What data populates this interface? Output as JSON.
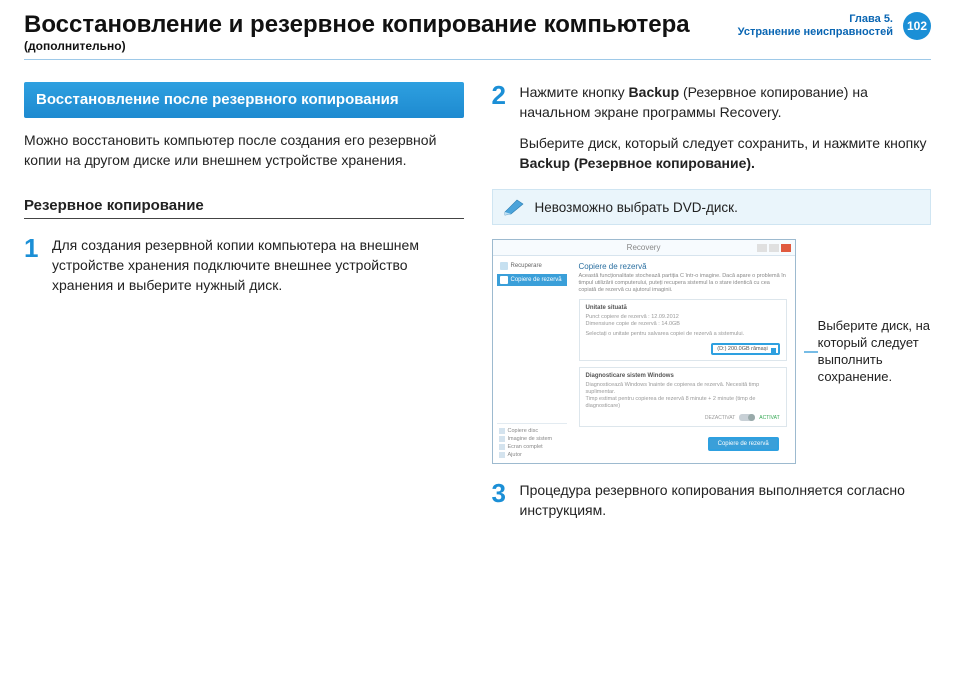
{
  "header": {
    "title": "Восстановление и резервное копирование компьютера",
    "subtitle": "(дополнительно)",
    "chapter_line1": "Глава 5.",
    "chapter_line2": "Устранение неисправностей",
    "page_number": "102"
  },
  "left": {
    "section_heading": "Восстановление после резервного копирования",
    "intro": "Можно восстановить компьютер после создания его резервной копии на другом диске или внешнем устройстве хранения.",
    "subhead": "Резервное копирование",
    "step1_num": "1",
    "step1_text": "Для создания резервной копии компьютера на внешнем устройстве хранения подключите внешнее устройство хранения и выберите нужный диск."
  },
  "right": {
    "step2_num": "2",
    "step2_text_pre": "Нажмите кнопку ",
    "step2_bold1": "Backup",
    "step2_text_mid": " (Резервное копирование) на начальном экране программы Recovery.",
    "step2b_pre": "Выберите диск, который следует сохранить, и нажмите кнопку ",
    "step2b_bold": "Backup (Резервное копирование).",
    "note_text": "Невозможно выбрать DVD-диск.",
    "callout": "Выберите диск, на который следует выполнить сохранение.",
    "step3_num": "3",
    "step3_text": "Процедура резервного копирования выполняется согласно инструкциям."
  },
  "screenshot": {
    "window_title": "Recovery",
    "side_item1": "Recuperare",
    "side_item2": "Copiere de rezervă",
    "main_heading": "Copiere de rezervă",
    "main_desc": "Această funcționalitate stochează partiția C într-o imagine. Dacă apare o problemă în timpul utilizării computerului, puteți recupera sistemul la o stare identică cu cea copiată de rezervă cu ajutorul imaginii.",
    "panel1_h": "Unitate situată",
    "panel1_line1": "Punct copiere de rezervă : 12.09.2012",
    "panel1_line2": "Dimensiune copie de rezervă : 14.0GB",
    "panel1_line3": "Selectați o unitate pentru salvarea copiei de rezervă a sistemului.",
    "select_value": "(D:) 200.0GB rămași",
    "panel2_h": "Diagnosticare sistem Windows",
    "panel2_line1": "Diagnosticează Windows înainte de copierea de rezervă. Necesită timp suplimentar.",
    "panel2_line2": "Timp estimat pentru copierea de rezervă 8 minute + 2 minute (timp de diagnosticare)",
    "toggle_off": "DEZACTIVAT",
    "toggle_on": "ACTIVAT",
    "bottom1": "Copiere disc",
    "bottom2": "Imagine de sistem",
    "bottom3": "Ecran complet",
    "bottom4": "Ajutor",
    "action_button": "Copiere de rezervă"
  }
}
